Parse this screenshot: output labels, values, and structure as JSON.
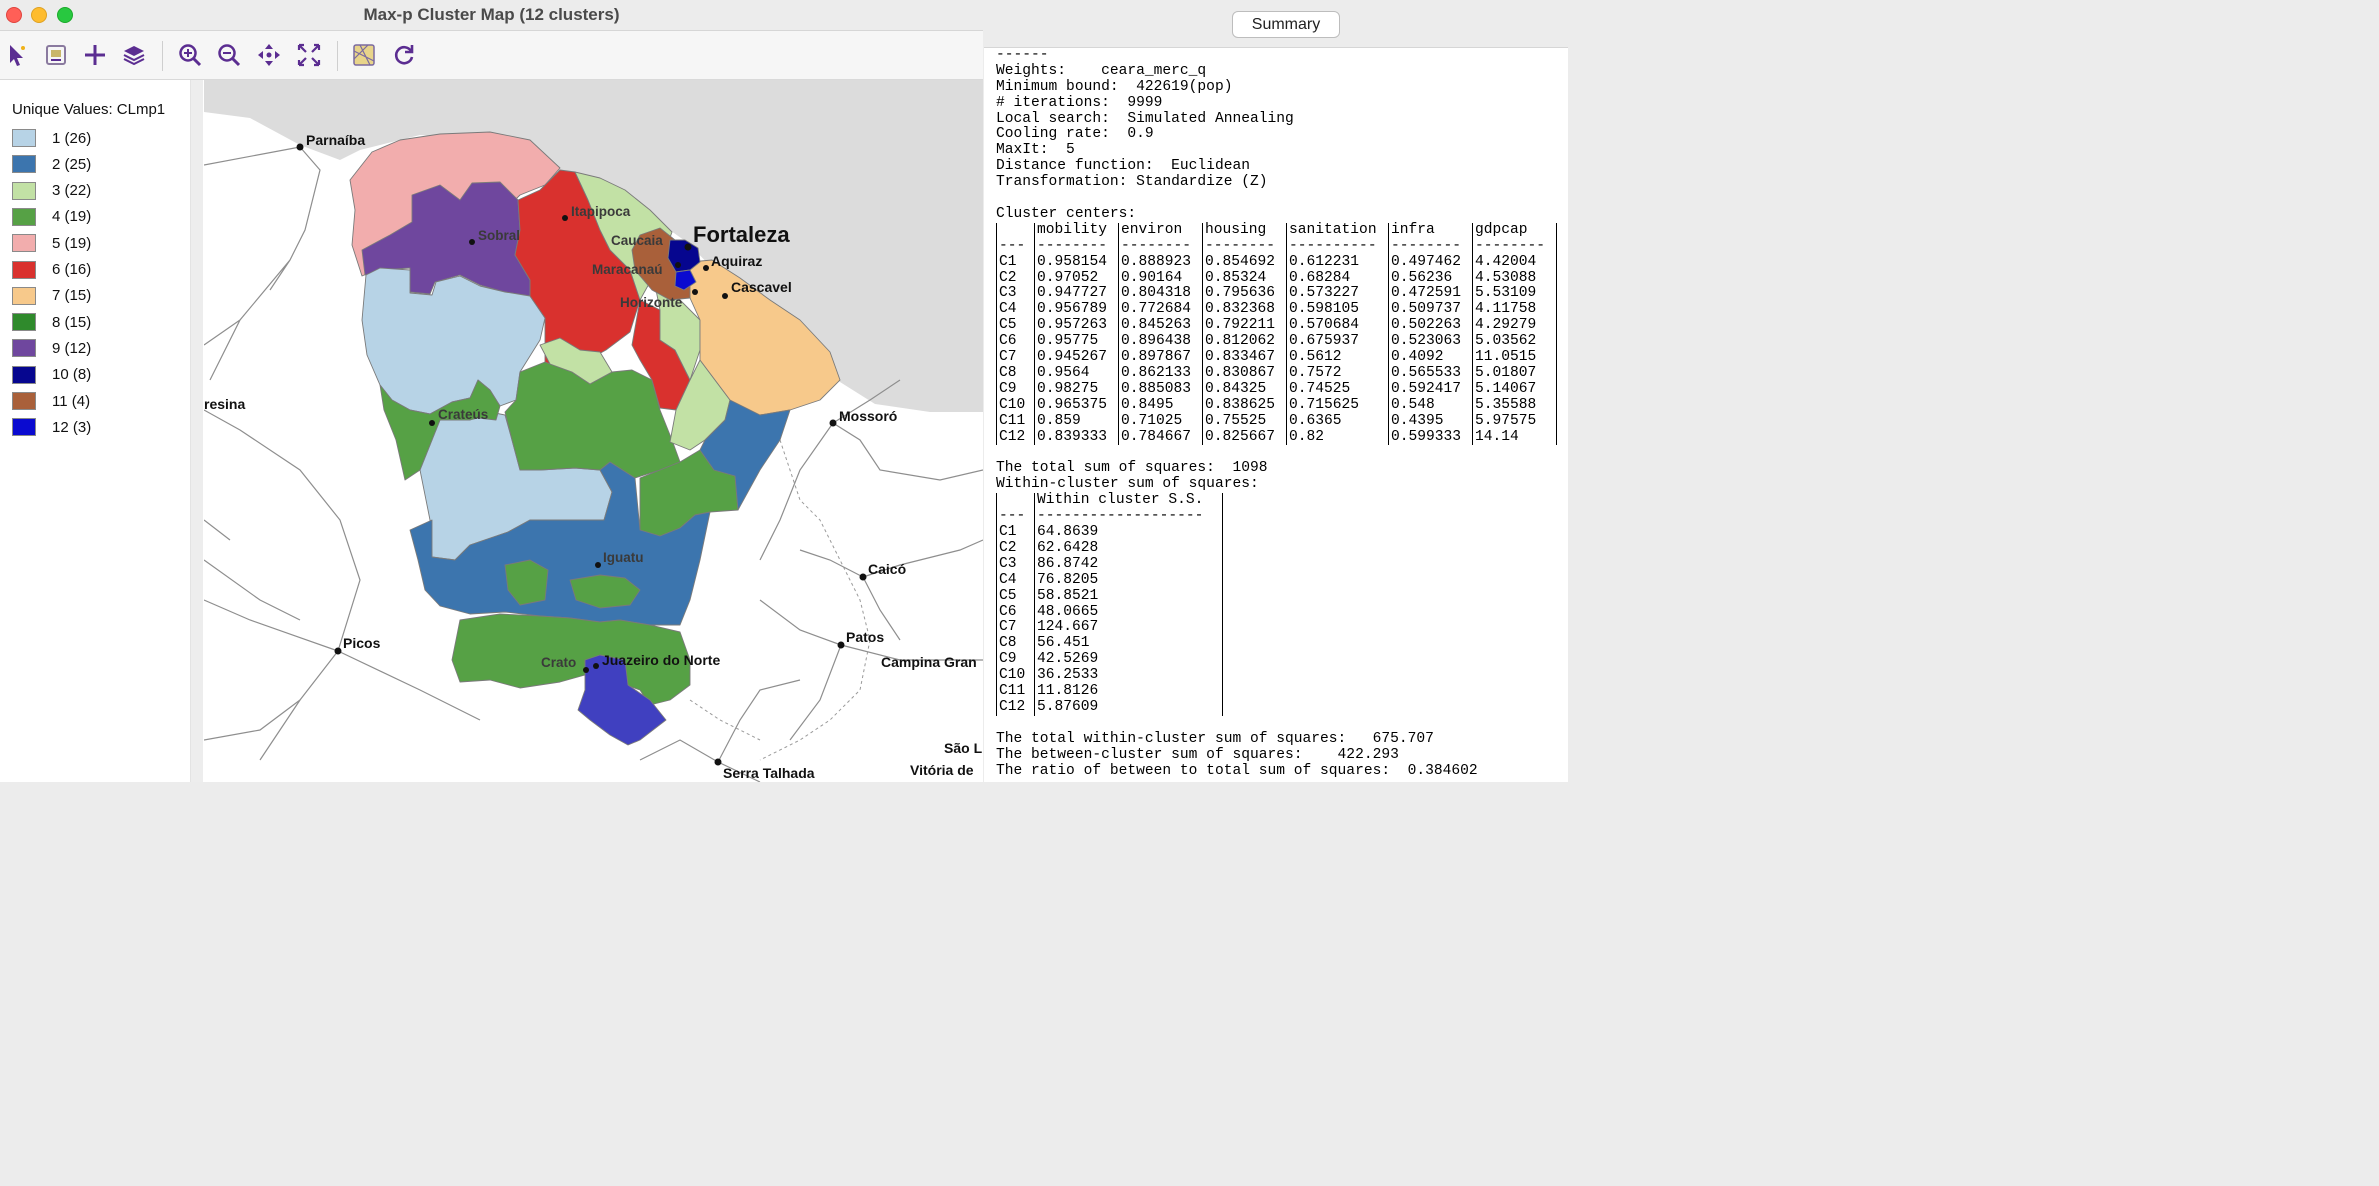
{
  "window": {
    "title": "Max-p Cluster Map (12 clusters)"
  },
  "toolbar": [
    "select-tool",
    "save-image",
    "add-layer",
    "layers",
    "zoom-in",
    "zoom-out",
    "pan",
    "full-extent",
    "map-background",
    "refresh"
  ],
  "legend": {
    "title": "Unique Values: CLmp1",
    "items": [
      {
        "label": "1 (26)",
        "color": "#b7d3e6"
      },
      {
        "label": "2 (25)",
        "color": "#3c75ae"
      },
      {
        "label": "3 (22)",
        "color": "#c2e1a5"
      },
      {
        "label": "4 (19)",
        "color": "#56a145"
      },
      {
        "label": "5 (19)",
        "color": "#f2adad"
      },
      {
        "label": "6 (16)",
        "color": "#d9312e"
      },
      {
        "label": "7 (15)",
        "color": "#f7c98b"
      },
      {
        "label": "8 (15)",
        "color": "#2f8a2c"
      },
      {
        "label": "9 (12)",
        "color": "#6f479e"
      },
      {
        "label": "10 (8)",
        "color": "#06068f"
      },
      {
        "label": "11 (4)",
        "color": "#a9603a"
      },
      {
        "label": "12 (3)",
        "color": "#0a0ad0"
      }
    ]
  },
  "map": {
    "places": {
      "parnaiba": "Parnaíba",
      "sobral": "Sobral",
      "itapipoca": "Itapipoca",
      "caucaia": "Caucaia",
      "fortaleza": "Fortaleza",
      "aquiraz": "Aquiraz",
      "maracanau": "Maracanaú",
      "cascavel": "Cascavel",
      "horizonte": "Horizonte",
      "teresina": "resina",
      "crateus": "Crateús",
      "mossoro": "Mossoró",
      "iguatu": "Iguatu",
      "caico": "Caicó",
      "picos": "Picos",
      "patos": "Patos",
      "campina": "Campina Gran",
      "crato": "Crato",
      "juazeiro": "Juazeiro do Norte",
      "saolu": "São L",
      "serra": "Serra Talhada",
      "vitoria": "Vitória de"
    }
  },
  "summary": {
    "tab": "Summary",
    "header_lines": [
      "------",
      "Weights:    ceara_merc_q",
      "Minimum bound:  422619(pop)",
      "# iterations:  9999",
      "Local search:  Simulated Annealing",
      "Cooling rate:  0.9",
      "MaxIt:  5",
      "Distance function:  Euclidean",
      "Transformation: Standardize (Z)"
    ],
    "centers_title": "Cluster centers:",
    "centers_columns": [
      "",
      "mobility",
      "environ",
      "housing",
      "sanitation",
      "infra",
      "gdpcap"
    ],
    "centers_dashes": [
      "---",
      "--------",
      "--------",
      "--------",
      "----------",
      "--------",
      "--------"
    ],
    "centers_rows": [
      [
        "C1",
        "0.958154",
        "0.888923",
        "0.854692",
        "0.612231",
        "0.497462",
        "4.42004"
      ],
      [
        "C2",
        "0.97052",
        "0.90164",
        "0.85324",
        "0.68284",
        "0.56236",
        "4.53088"
      ],
      [
        "C3",
        "0.947727",
        "0.804318",
        "0.795636",
        "0.573227",
        "0.472591",
        "5.53109"
      ],
      [
        "C4",
        "0.956789",
        "0.772684",
        "0.832368",
        "0.598105",
        "0.509737",
        "4.11758"
      ],
      [
        "C5",
        "0.957263",
        "0.845263",
        "0.792211",
        "0.570684",
        "0.502263",
        "4.29279"
      ],
      [
        "C6",
        "0.95775",
        "0.896438",
        "0.812062",
        "0.675937",
        "0.523063",
        "5.03562"
      ],
      [
        "C7",
        "0.945267",
        "0.897867",
        "0.833467",
        "0.5612",
        "0.4092",
        "11.0515"
      ],
      [
        "C8",
        "0.9564",
        "0.862133",
        "0.830867",
        "0.7572",
        "0.565533",
        "5.01807"
      ],
      [
        "C9",
        "0.98275",
        "0.885083",
        "0.84325",
        "0.74525",
        "0.592417",
        "5.14067"
      ],
      [
        "C10",
        "0.965375",
        "0.8495",
        "0.838625",
        "0.715625",
        "0.548",
        "5.35588"
      ],
      [
        "C11",
        "0.859",
        "0.71025",
        "0.75525",
        "0.6365",
        "0.4395",
        "5.97575"
      ],
      [
        "C12",
        "0.839333",
        "0.784667",
        "0.825667",
        "0.82",
        "0.599333",
        "14.14"
      ]
    ],
    "total_ss": "The total sum of squares:  1098",
    "within_title": "Within-cluster sum of squares:",
    "within_columns": [
      "",
      "Within cluster S.S."
    ],
    "within_dashes": [
      "---",
      "-------------------"
    ],
    "within_rows": [
      [
        "C1",
        "64.8639"
      ],
      [
        "C2",
        "62.6428"
      ],
      [
        "C3",
        "86.8742"
      ],
      [
        "C4",
        "76.8205"
      ],
      [
        "C5",
        "58.8521"
      ],
      [
        "C6",
        "48.0665"
      ],
      [
        "C7",
        "124.667"
      ],
      [
        "C8",
        "56.451"
      ],
      [
        "C9",
        "42.5269"
      ],
      [
        "C10",
        "36.2533"
      ],
      [
        "C11",
        "11.8126"
      ],
      [
        "C12",
        "5.87609"
      ]
    ],
    "footer_lines": [
      "The total within-cluster sum of squares:   675.707",
      "The between-cluster sum of squares:    422.293",
      "The ratio of between to total sum of squares:  0.384602"
    ]
  }
}
